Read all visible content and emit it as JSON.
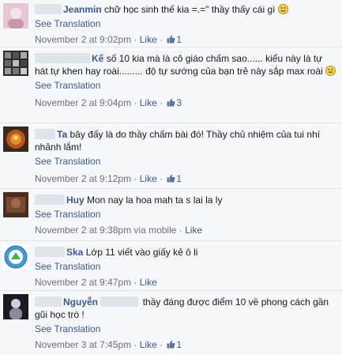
{
  "comments": [
    {
      "name": "Jeanmin",
      "text": "chữ học sinh thế kia =.=\" thầy thấy cái gì",
      "see_translation": "See Translation",
      "date": "November 2 at 9:02pm",
      "like_label": "Like",
      "like_count": "1",
      "via": ""
    },
    {
      "name": "Kế",
      "text": "số 10 kia mà là cô giáo chấm sao...... kiểu này là tự hát tự khen hay roài......... độ tự sướng của bạn trẻ này sắp max roài",
      "see_translation": "See Translation",
      "date": "November 2 at 9:04pm",
      "like_label": "Like",
      "like_count": "3",
      "via": ""
    },
    {
      "name": "Ta",
      "text": "bây đấy là do thầy chấm bài đó! Thầy chủ nhiệm của tui nhí nhảnh lắm!",
      "see_translation": "See Translation",
      "date": "November 2 at 9:12pm",
      "like_label": "Like",
      "like_count": "1",
      "via": ""
    },
    {
      "name": "Huy",
      "text": "Mon nay la hoa mah ta s lai la ly",
      "see_translation": "See Translation",
      "date": "November 2 at 9:38pm",
      "like_label": "Like",
      "like_count": "",
      "via": "via mobile"
    },
    {
      "name": "Ska",
      "text": "Lớp 11 viết vào giấy kẻ ô li",
      "see_translation": "See Translation",
      "date": "November 2 at 9:47pm",
      "like_label": "Like",
      "like_count": "",
      "via": ""
    },
    {
      "name": "Nguyễn",
      "text": "thầy đáng được điểm 10 về phong cách gần gũi học trò !",
      "see_translation": "See Translation",
      "date": "November 3 at 7:45pm",
      "like_label": "Like",
      "like_count": "1",
      "via": ""
    }
  ],
  "colors": {
    "link": "#3b5998",
    "background": "#f6f7f9",
    "meta": "#6a7180"
  }
}
